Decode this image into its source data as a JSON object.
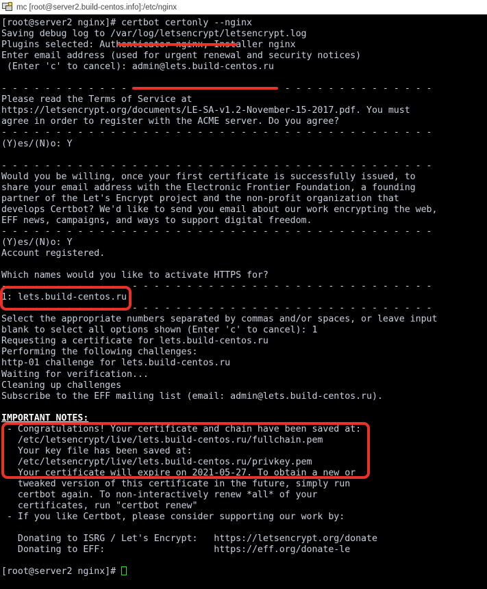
{
  "window": {
    "title": "mc [root@server2.build-centos.info]:/etc/nginx",
    "icon": "terminal-window-icon"
  },
  "theme": {
    "background": "#000000",
    "foreground": "#c8d0dc",
    "cursor": "#2ee02e",
    "annotation": "#e8322a",
    "titlebar_bg": "#ffffff",
    "titlebar_fg": "#444444"
  },
  "terminal": {
    "prompt_top": "[root@server2 nginx]# certbot certonly --nginx",
    "prompt_bottom": "[root@server2 nginx]# ",
    "lines": [
      {
        "text": "[root@server2 nginx]# certbot certonly --nginx"
      },
      {
        "text": "Saving debug log to /var/log/letsencrypt/letsencrypt.log"
      },
      {
        "text": "Plugins selected: Authenticator nginx, Installer nginx"
      },
      {
        "text": "Enter email address (used for urgent renewal and security notices)"
      },
      {
        "text": " (Enter 'c' to cancel): admin@lets.build-centos.ru"
      },
      {
        "text": ""
      },
      {
        "text": "- - - - - - - - - - - - - - - - - - - - - - - - - - - - - - - - - - - - - - - -"
      },
      {
        "text": "Please read the Terms of Service at"
      },
      {
        "text": "https://letsencrypt.org/documents/LE-SA-v1.2-November-15-2017.pdf. You must"
      },
      {
        "text": "agree in order to register with the ACME server. Do you agree?"
      },
      {
        "text": "- - - - - - - - - - - - - - - - - - - - - - - - - - - - - - - - - - - - - - - -"
      },
      {
        "text": "(Y)es/(N)o: Y"
      },
      {
        "text": ""
      },
      {
        "text": "- - - - - - - - - - - - - - - - - - - - - - - - - - - - - - - - - - - - - - - -"
      },
      {
        "text": "Would you be willing, once your first certificate is successfully issued, to"
      },
      {
        "text": "share your email address with the Electronic Frontier Foundation, a founding"
      },
      {
        "text": "partner of the Let's Encrypt project and the non-profit organization that"
      },
      {
        "text": "develops Certbot? We'd like to send you email about our work encrypting the web,"
      },
      {
        "text": "EFF news, campaigns, and ways to support digital freedom."
      },
      {
        "text": "- - - - - - - - - - - - - - - - - - - - - - - - - - - - - - - - - - - - - - - -"
      },
      {
        "text": "(Y)es/(N)o: Y"
      },
      {
        "text": "Account registered."
      },
      {
        "text": ""
      },
      {
        "text": "Which names would you like to activate HTTPS for?"
      },
      {
        "text": "- - - - - - - - - - - - - - - - - - - - - - - - - - - - - - - - - - - - - - - -"
      },
      {
        "text": "1: lets.build-centos.ru"
      },
      {
        "text": "- - - - - - - - - - - - - - - - - - - - - - - - - - - - - - - - - - - - - - - -"
      },
      {
        "text": "Select the appropriate numbers separated by commas and/or spaces, or leave input"
      },
      {
        "text": "blank to select all options shown (Enter 'c' to cancel): 1"
      },
      {
        "text": "Requesting a certificate for lets.build-centos.ru"
      },
      {
        "text": "Performing the following challenges:"
      },
      {
        "text": "http-01 challenge for lets.build-centos.ru"
      },
      {
        "text": "Waiting for verification..."
      },
      {
        "text": "Cleaning up challenges"
      },
      {
        "text": "Subscribe to the EFF mailing list (email: admin@lets.build-centos.ru)."
      },
      {
        "text": ""
      },
      {
        "text": "IMPORTANT NOTES:",
        "style": "bold"
      },
      {
        "text": " - Congratulations! Your certificate and chain have been saved at:"
      },
      {
        "text": "   /etc/letsencrypt/live/lets.build-centos.ru/fullchain.pem"
      },
      {
        "text": "   Your key file has been saved at:"
      },
      {
        "text": "   /etc/letsencrypt/live/lets.build-centos.ru/privkey.pem"
      },
      {
        "text": "   Your certificate will expire on 2021-05-27. To obtain a new or"
      },
      {
        "text": "   tweaked version of this certificate in the future, simply run"
      },
      {
        "text": "   certbot again. To non-interactively renew *all* of your"
      },
      {
        "text": "   certificates, run \"certbot renew\""
      },
      {
        "text": " - If you like Certbot, please consider supporting our work by:"
      },
      {
        "text": ""
      },
      {
        "text": "   Donating to ISRG / Let's Encrypt:   https://letsencrypt.org/donate"
      },
      {
        "text": "   Donating to EFF:                    https://eff.org/donate-le"
      },
      {
        "text": ""
      },
      {
        "text": "[root@server2 nginx]# "
      }
    ]
  },
  "annotations": [
    {
      "kind": "underline",
      "target": "certbot certonly --nginx"
    },
    {
      "kind": "underline",
      "target": "admin@lets.build-centos.ru"
    },
    {
      "kind": "box",
      "target": "1: lets.build-centos.ru"
    },
    {
      "kind": "box",
      "target": "certificate and key file paths"
    }
  ]
}
